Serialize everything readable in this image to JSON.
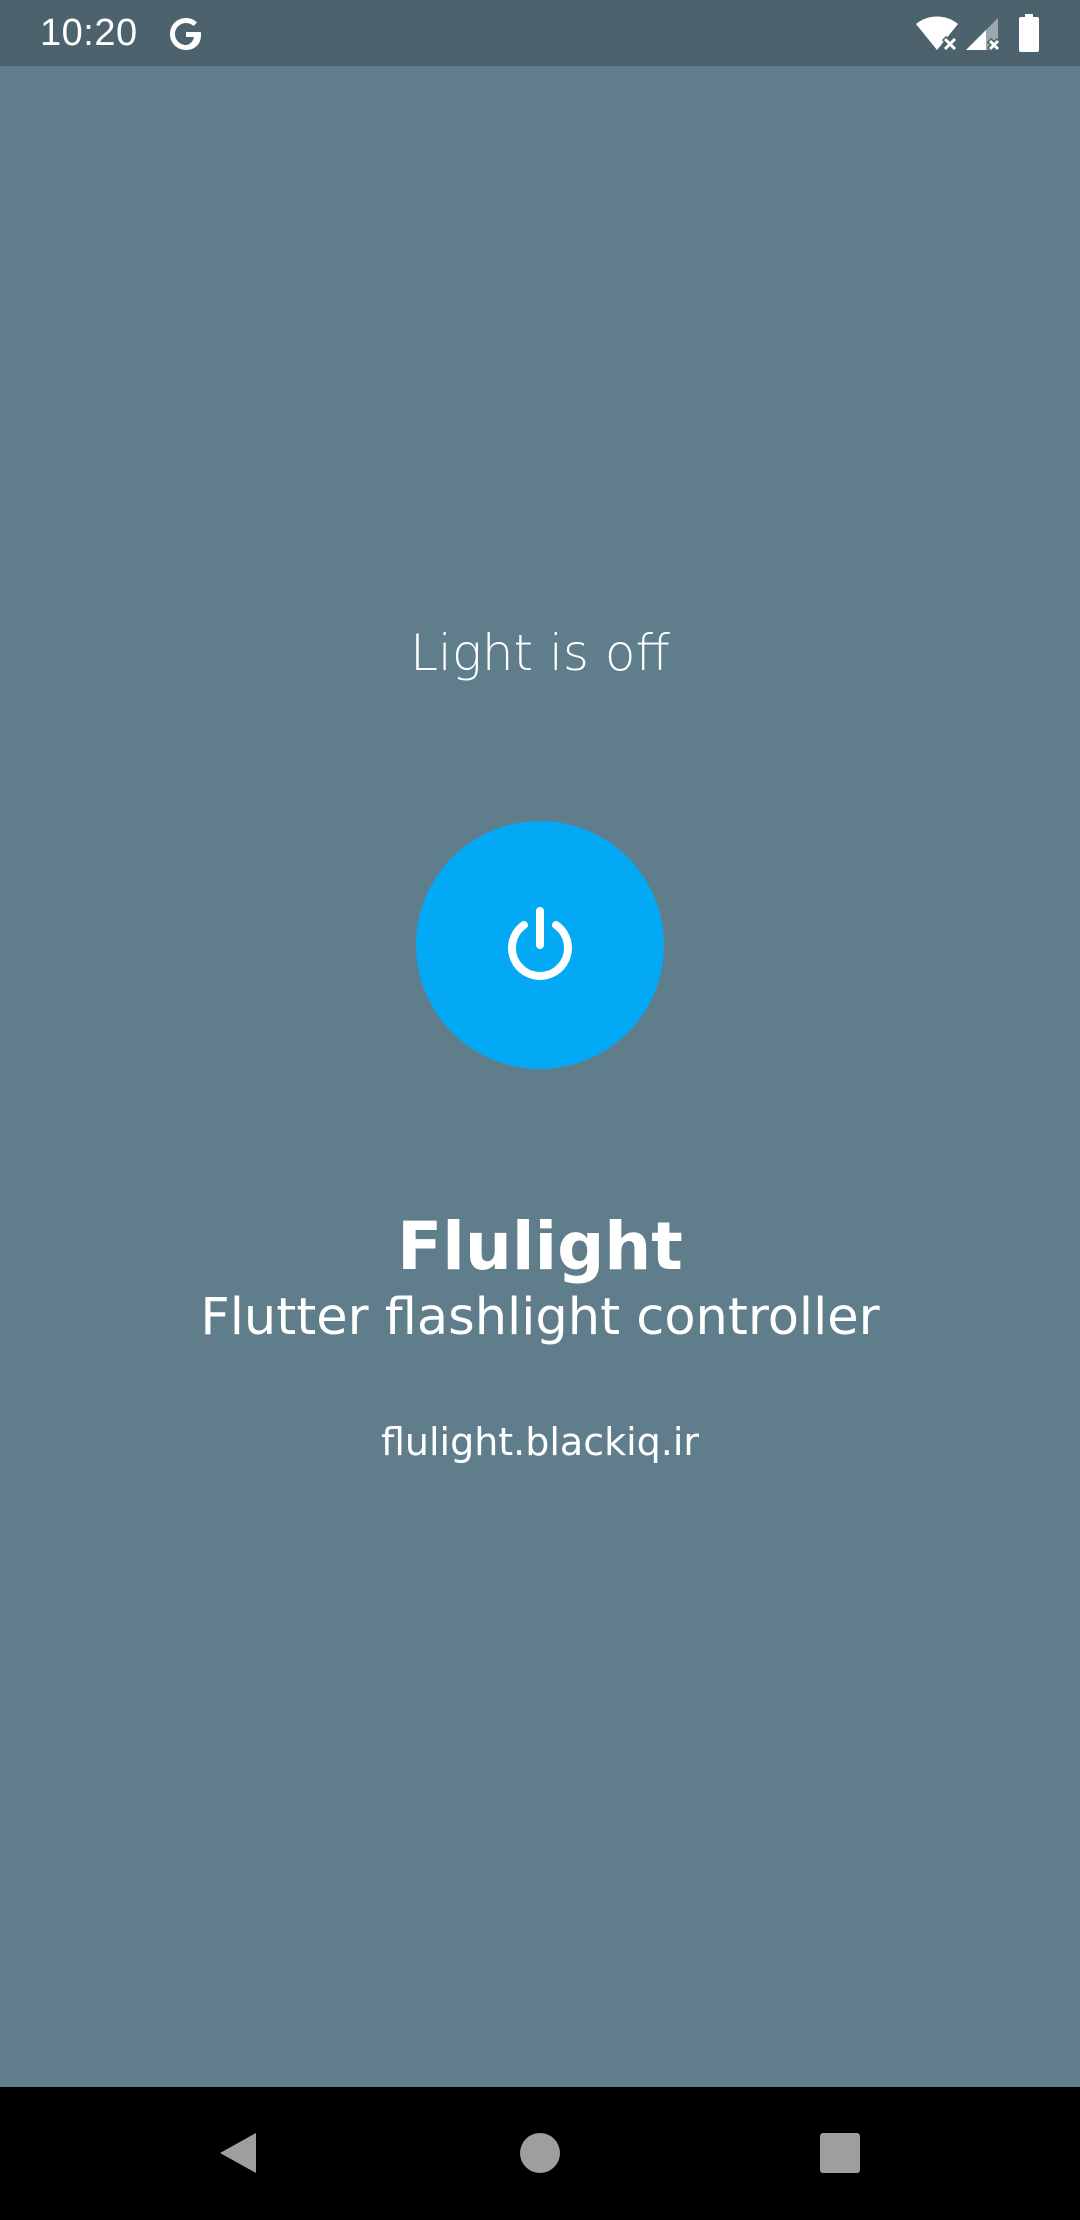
{
  "status_bar": {
    "time": "10:20",
    "icons": [
      "google-g-icon",
      "wifi-icon",
      "cellular-signal-icon",
      "battery-icon"
    ]
  },
  "main": {
    "light_status": "Light is off",
    "power_button_icon": "power-icon",
    "app_title": "Flulight",
    "app_subtitle": "Flutter flashlight controller",
    "app_url": "flulight.blackiq.ir"
  },
  "navigation_bar": {
    "icons": [
      "back-icon",
      "home-icon",
      "recents-icon"
    ]
  },
  "colors": {
    "background": "#607D8B",
    "status_bar": "#4C626D",
    "accent": "#03A9F4",
    "text": "#FFFFFF",
    "nav_bar": "#000000",
    "nav_icon": "#9E9E9E"
  }
}
